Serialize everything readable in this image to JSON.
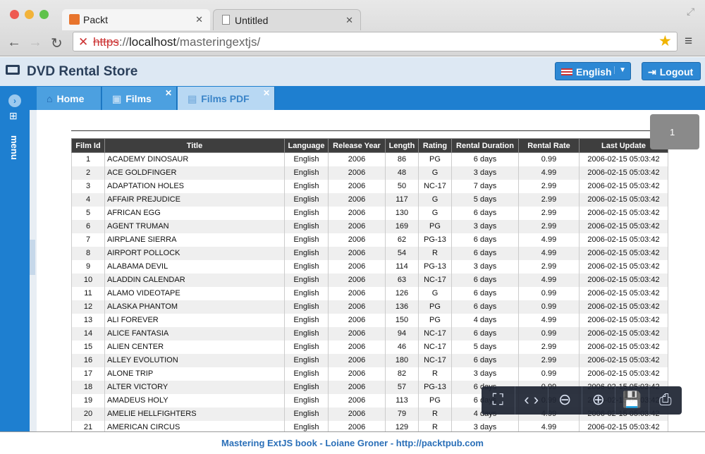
{
  "browser": {
    "tabs": [
      {
        "label": "Packt"
      },
      {
        "label": "Untitled"
      }
    ],
    "url_scheme": "https",
    "url_sep": "://",
    "url_host": "localhost",
    "url_path": "/masteringextjs/"
  },
  "app": {
    "title": "DVD Rental Store",
    "language": "English",
    "logout": "Logout",
    "menu": "menu",
    "tabs": [
      {
        "label": "Home"
      },
      {
        "label": "Films"
      },
      {
        "label": "Films PDF"
      }
    ]
  },
  "pdf": {
    "page": "1",
    "columns": [
      "Film Id",
      "Title",
      "Language",
      "Release Year",
      "Length",
      "Rating",
      "Rental Duration",
      "Rental Rate",
      "Last Update"
    ],
    "rows": [
      [
        "1",
        "ACADEMY DINOSAUR",
        "English",
        "2006",
        "86",
        "PG",
        "6 days",
        "0.99",
        "2006-02-15 05:03:42"
      ],
      [
        "2",
        "ACE GOLDFINGER",
        "English",
        "2006",
        "48",
        "G",
        "3 days",
        "4.99",
        "2006-02-15 05:03:42"
      ],
      [
        "3",
        "ADAPTATION HOLES",
        "English",
        "2006",
        "50",
        "NC-17",
        "7 days",
        "2.99",
        "2006-02-15 05:03:42"
      ],
      [
        "4",
        "AFFAIR PREJUDICE",
        "English",
        "2006",
        "117",
        "G",
        "5 days",
        "2.99",
        "2006-02-15 05:03:42"
      ],
      [
        "5",
        "AFRICAN EGG",
        "English",
        "2006",
        "130",
        "G",
        "6 days",
        "2.99",
        "2006-02-15 05:03:42"
      ],
      [
        "6",
        "AGENT TRUMAN",
        "English",
        "2006",
        "169",
        "PG",
        "3 days",
        "2.99",
        "2006-02-15 05:03:42"
      ],
      [
        "7",
        "AIRPLANE SIERRA",
        "English",
        "2006",
        "62",
        "PG-13",
        "6 days",
        "4.99",
        "2006-02-15 05:03:42"
      ],
      [
        "8",
        "AIRPORT POLLOCK",
        "English",
        "2006",
        "54",
        "R",
        "6 days",
        "4.99",
        "2006-02-15 05:03:42"
      ],
      [
        "9",
        "ALABAMA DEVIL",
        "English",
        "2006",
        "114",
        "PG-13",
        "3 days",
        "2.99",
        "2006-02-15 05:03:42"
      ],
      [
        "10",
        "ALADDIN CALENDAR",
        "English",
        "2006",
        "63",
        "NC-17",
        "6 days",
        "4.99",
        "2006-02-15 05:03:42"
      ],
      [
        "11",
        "ALAMO VIDEOTAPE",
        "English",
        "2006",
        "126",
        "G",
        "6 days",
        "0.99",
        "2006-02-15 05:03:42"
      ],
      [
        "12",
        "ALASKA PHANTOM",
        "English",
        "2006",
        "136",
        "PG",
        "6 days",
        "0.99",
        "2006-02-15 05:03:42"
      ],
      [
        "13",
        "ALI FOREVER",
        "English",
        "2006",
        "150",
        "PG",
        "4 days",
        "4.99",
        "2006-02-15 05:03:42"
      ],
      [
        "14",
        "ALICE FANTASIA",
        "English",
        "2006",
        "94",
        "NC-17",
        "6 days",
        "0.99",
        "2006-02-15 05:03:42"
      ],
      [
        "15",
        "ALIEN CENTER",
        "English",
        "2006",
        "46",
        "NC-17",
        "5 days",
        "2.99",
        "2006-02-15 05:03:42"
      ],
      [
        "16",
        "ALLEY EVOLUTION",
        "English",
        "2006",
        "180",
        "NC-17",
        "6 days",
        "2.99",
        "2006-02-15 05:03:42"
      ],
      [
        "17",
        "ALONE TRIP",
        "English",
        "2006",
        "82",
        "R",
        "3 days",
        "0.99",
        "2006-02-15 05:03:42"
      ],
      [
        "18",
        "ALTER VICTORY",
        "English",
        "2006",
        "57",
        "PG-13",
        "6 days",
        "0.99",
        "2006-02-15 05:03:42"
      ],
      [
        "19",
        "AMADEUS HOLY",
        "English",
        "2006",
        "113",
        "PG",
        "6 days",
        "0.99",
        "2006-02-15 05:03:42"
      ],
      [
        "20",
        "AMELIE HELLFIGHTERS",
        "English",
        "2006",
        "79",
        "R",
        "4 days",
        "4.99",
        "2006-02-15 05:03:42"
      ],
      [
        "21",
        "AMERICAN CIRCUS",
        "English",
        "2006",
        "129",
        "R",
        "3 days",
        "4.99",
        "2006-02-15 05:03:42"
      ]
    ]
  },
  "toolbar_icons": [
    "fit-page-icon",
    "fit-width-icon",
    "zoom-out-icon",
    "zoom-in-icon",
    "save-icon",
    "print-icon"
  ],
  "footer": "Mastering ExtJS book - Loiane Groner - http://packtpub.com"
}
